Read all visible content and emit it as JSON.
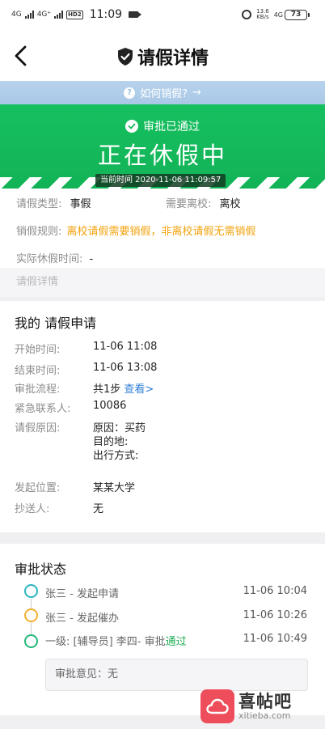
{
  "status_bar": {
    "signal1": "4G",
    "signal2": "4G⁺",
    "hd": "HD",
    "hd_sub": "2",
    "time": "11:09",
    "speed_value": "13.6",
    "speed_unit": "KB/s",
    "net": "4G",
    "battery": "73"
  },
  "header": {
    "title": "请假详情"
  },
  "how_bar": {
    "label": "如何销假?",
    "arrow": "→"
  },
  "banner": {
    "approved": "审批已通过",
    "state": "正在休假中",
    "current_time": "当前时间 2020-11-06 11:09:57",
    "color": "#16c05f"
  },
  "info": {
    "leave_type_label": "请假类型:",
    "leave_type": "事假",
    "need_leave_label": "需要离校:",
    "need_leave": "离校",
    "rule_label": "销假规则:",
    "rule": "离校请假需要销假，非离校请假无需销假",
    "actual_label": "实际休假时间:",
    "actual": "-"
  },
  "section_caption": "请假详情",
  "application": {
    "title": "我的 请假申请",
    "start_label": "开始时间:",
    "start": "11-06 11:08",
    "end_label": "结束时间:",
    "end": "11-06 13:08",
    "flow_label": "审批流程:",
    "flow": "共1步",
    "flow_link": "查看>",
    "contact_label": "紧急联系人:",
    "contact": "10086",
    "reason_label": "请假原因:",
    "reason_line1": "原因：买药",
    "reason_line2": "目的地:",
    "reason_line3": "出行方式:",
    "location_label": "发起位置:",
    "location": "某某大学",
    "cc_label": "抄送人:",
    "cc": "无"
  },
  "approval": {
    "title": "审批状态",
    "steps": [
      {
        "text": "张三 - 发起申请",
        "time": "11-06 10:04"
      },
      {
        "text": "张三 - 发起催办",
        "time": "11-06 10:26"
      },
      {
        "text_prefix": "一级: [辅导员] 李四- 审批",
        "text_status": "通过",
        "time": "11-06 10:49"
      }
    ],
    "opinion": "审批意见：无"
  },
  "watermark": {
    "name": "喜帖吧",
    "url": "xitieba.com"
  }
}
